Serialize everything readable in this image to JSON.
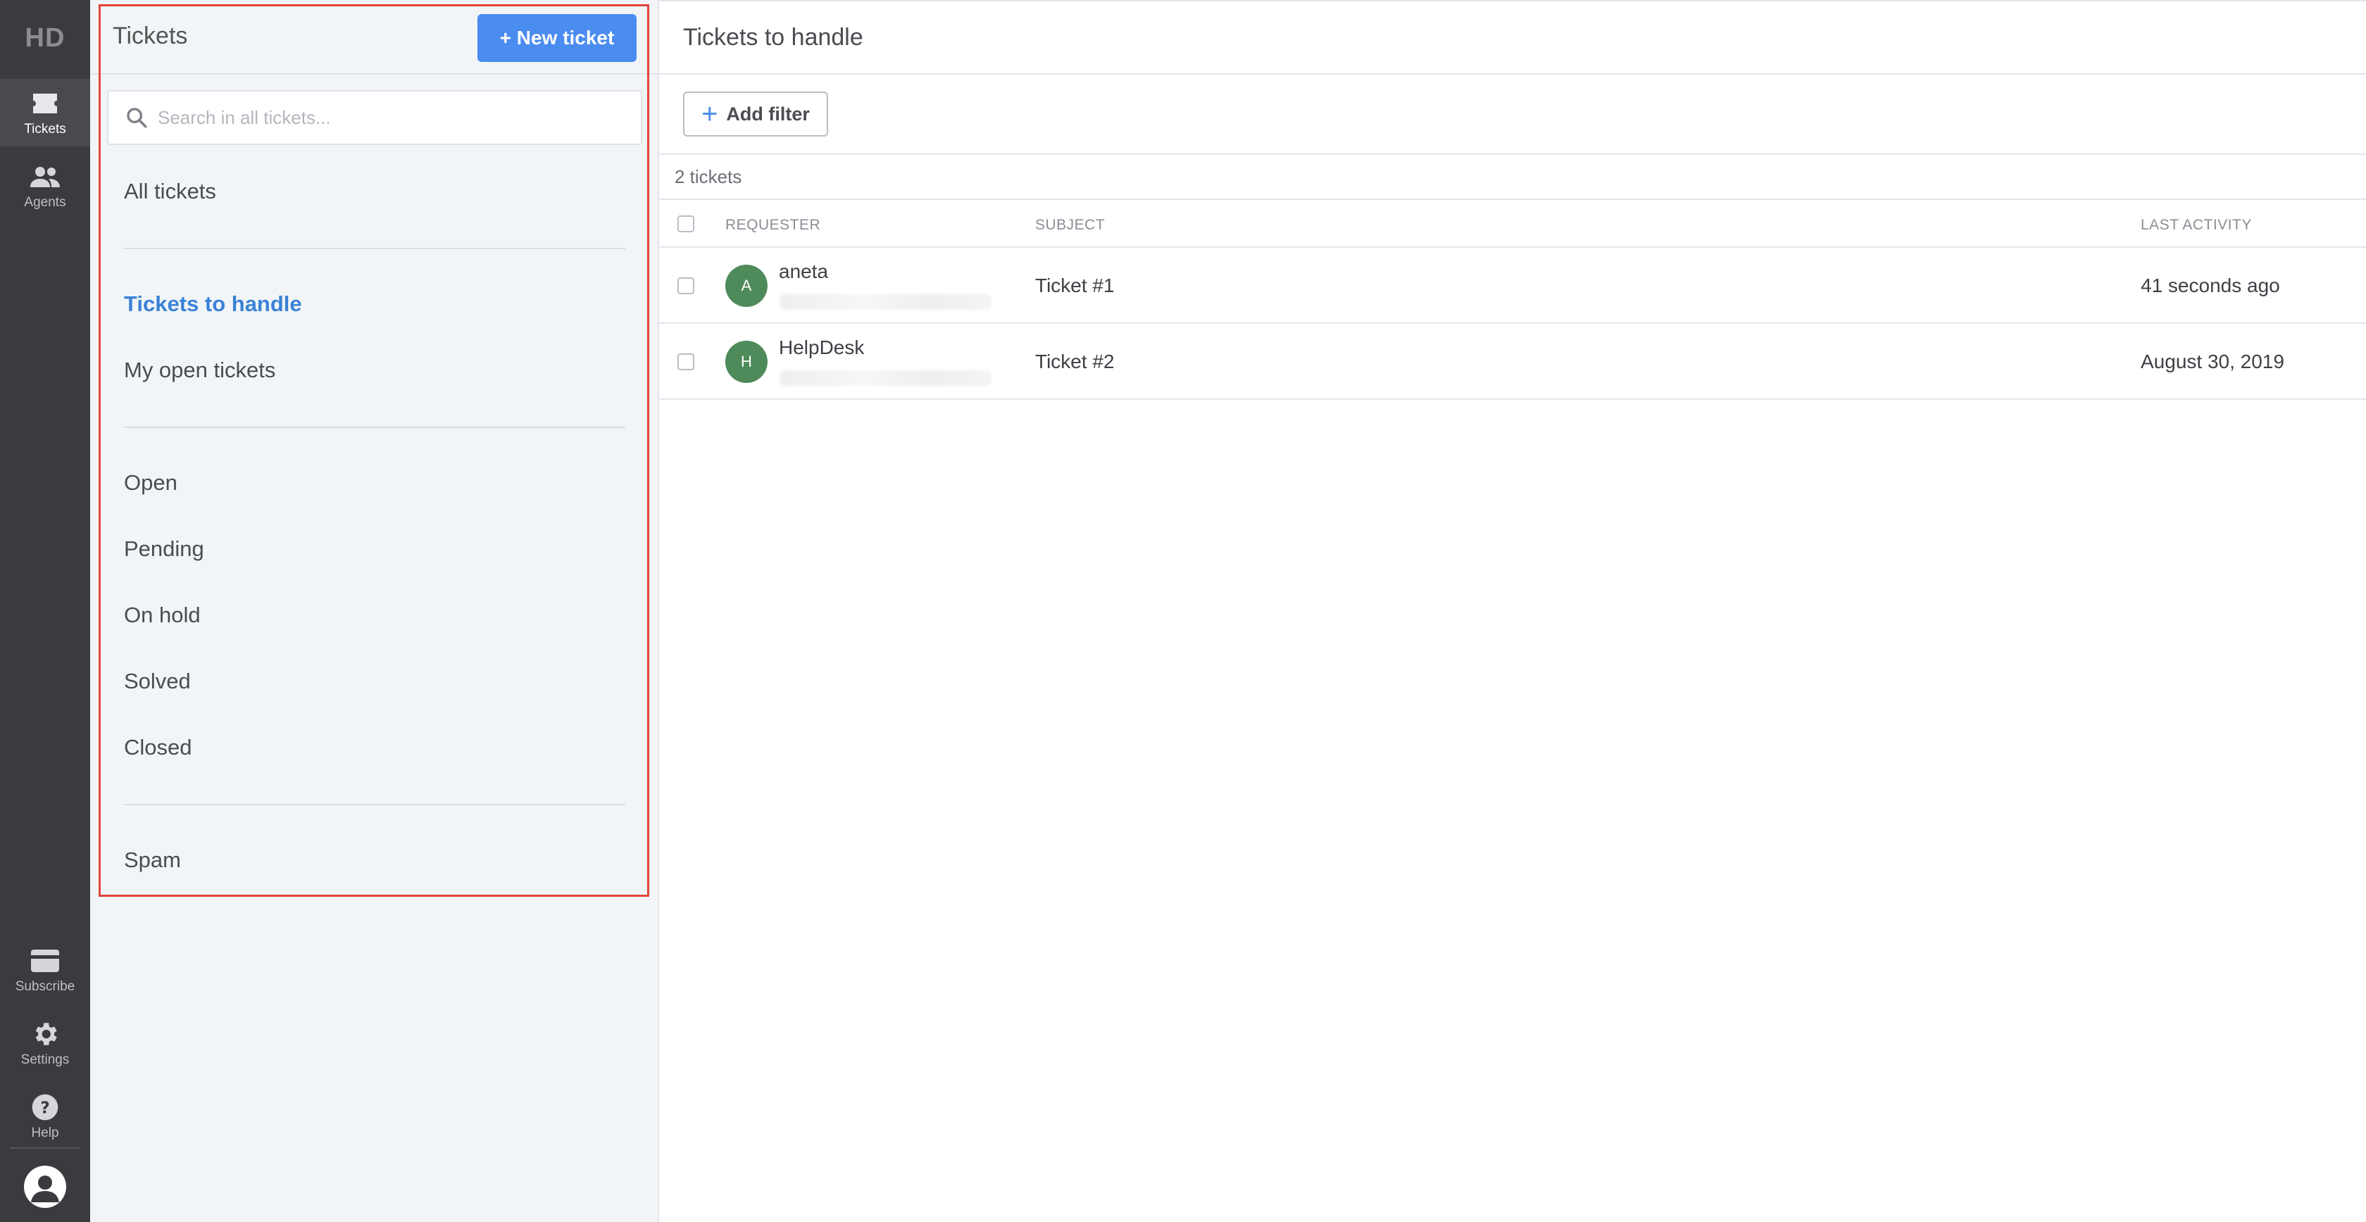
{
  "rail": {
    "logo": "HD",
    "items": [
      {
        "label": "Tickets",
        "icon": "ticket-icon"
      },
      {
        "label": "Agents",
        "icon": "agents-icon"
      },
      {
        "label": "Subscribe",
        "icon": "subscribe-icon"
      },
      {
        "label": "Settings",
        "icon": "gear-icon"
      },
      {
        "label": "Help",
        "icon": "help-icon"
      }
    ],
    "user_icon": "user-avatar-icon"
  },
  "panel": {
    "title": "Tickets",
    "new_ticket_label": "+ New ticket",
    "search_placeholder": "Search in all tickets...",
    "folders": {
      "all": "All tickets",
      "to_handle": "Tickets to handle",
      "my_open": "My open tickets",
      "open": "Open",
      "pending": "Pending",
      "on_hold": "On hold",
      "solved": "Solved",
      "closed": "Closed",
      "spam": "Spam"
    },
    "active_folder": "to_handle"
  },
  "main": {
    "title": "Tickets to handle",
    "add_filter_label": "Add filter",
    "count_text": "2 tickets",
    "columns": {
      "requester": "REQUESTER",
      "subject": "SUBJECT",
      "last_activity": "LAST ACTIVITY"
    },
    "rows": [
      {
        "initial": "A",
        "requester": "aneta",
        "subject": "Ticket #1",
        "last_activity": "41 seconds ago"
      },
      {
        "initial": "H",
        "requester": "HelpDesk",
        "subject": "Ticket #2",
        "last_activity": "August 30, 2019"
      }
    ]
  },
  "colors": {
    "accent": "#4a8cf0",
    "active_folder": "#3b82d6",
    "rail_bg": "#3b3a3f",
    "panel_bg": "#f1f5f8",
    "avatar": "#4e8a5a",
    "highlight_frame": "#e2453a"
  }
}
